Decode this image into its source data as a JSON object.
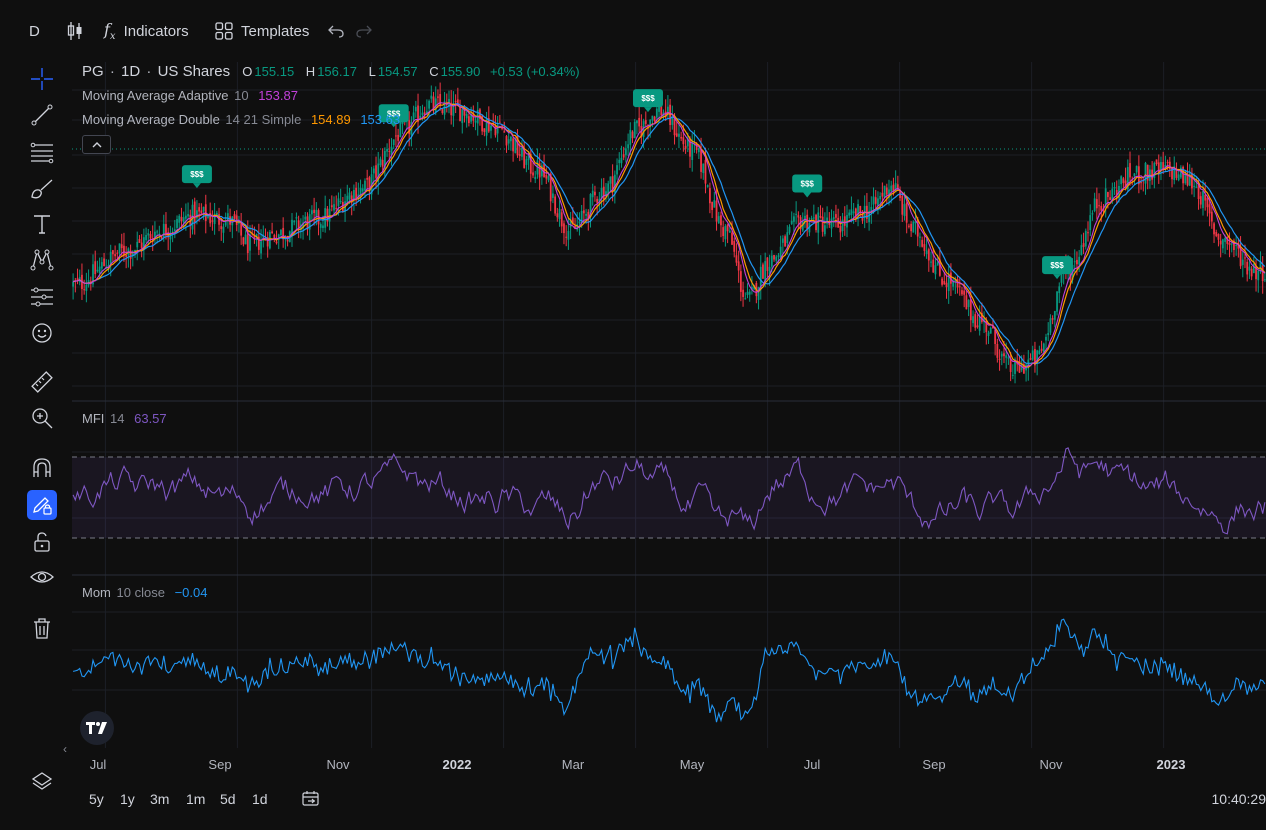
{
  "toolbar": {
    "interval": "D",
    "indicators_label": "Indicators",
    "templates_label": "Templates"
  },
  "legend": {
    "symbol": "PG",
    "interval": "1D",
    "exchange": "US Shares",
    "open_label": "O",
    "open": "155.15",
    "high_label": "H",
    "high": "156.17",
    "low_label": "L",
    "low": "154.57",
    "close_label": "C",
    "close": "155.90",
    "change": "+0.53 (+0.34%)",
    "ma_adaptive_name": "Moving Average Adaptive",
    "ma_adaptive_params": "10",
    "ma_adaptive_value": "153.87",
    "ma_double_name": "Moving Average Double",
    "ma_double_params": "14 21 Simple",
    "ma_double_value1": "154.89",
    "ma_double_value2": "153.63"
  },
  "mfi": {
    "name": "MFI",
    "params": "14",
    "value": "63.57"
  },
  "mom": {
    "name": "Mom",
    "params": "10 close",
    "value": "−0.04"
  },
  "colors": {
    "up": "#089981",
    "down": "#f23645",
    "ma_adaptive": "#c240d9",
    "ma_fast": "#ff9800",
    "ma_slow": "#2196f3",
    "mfi": "#7e57c2",
    "mom": "#2196f3",
    "accent": "#2962ff"
  },
  "dividend_badge": "$$$",
  "chart_data": {
    "type": "candlestick",
    "x_ticks": [
      "Jul",
      "Sep",
      "Nov",
      "2022",
      "Mar",
      "May",
      "Jul",
      "Sep",
      "Nov",
      "2023"
    ],
    "price_anchors": [
      {
        "t": 0,
        "p": 144.5
      },
      {
        "t": 25,
        "p": 148
      },
      {
        "t": 40,
        "p": 150
      },
      {
        "t": 55,
        "p": 151.5
      },
      {
        "t": 70,
        "p": 151
      },
      {
        "t": 80,
        "p": 148.5
      },
      {
        "t": 90,
        "p": 149.5
      },
      {
        "t": 110,
        "p": 151
      },
      {
        "t": 130,
        "p": 154
      },
      {
        "t": 150,
        "p": 160
      },
      {
        "t": 160,
        "p": 162.5
      },
      {
        "t": 175,
        "p": 162
      },
      {
        "t": 190,
        "p": 160.5
      },
      {
        "t": 210,
        "p": 156
      },
      {
        "t": 225,
        "p": 150
      },
      {
        "t": 240,
        "p": 154
      },
      {
        "t": 255,
        "p": 160
      },
      {
        "t": 265,
        "p": 162
      },
      {
        "t": 280,
        "p": 158
      },
      {
        "t": 295,
        "p": 150
      },
      {
        "t": 305,
        "p": 143
      },
      {
        "t": 315,
        "p": 147
      },
      {
        "t": 330,
        "p": 151
      },
      {
        "t": 345,
        "p": 150.5
      },
      {
        "t": 360,
        "p": 152
      },
      {
        "t": 370,
        "p": 154.5
      },
      {
        "t": 380,
        "p": 150
      },
      {
        "t": 395,
        "p": 145
      },
      {
        "t": 410,
        "p": 141
      },
      {
        "t": 425,
        "p": 136
      },
      {
        "t": 435,
        "p": 137
      },
      {
        "t": 450,
        "p": 146
      },
      {
        "t": 465,
        "p": 153
      },
      {
        "t": 480,
        "p": 155.5
      },
      {
        "t": 495,
        "p": 156
      },
      {
        "t": 505,
        "p": 155
      },
      {
        "t": 520,
        "p": 149
      },
      {
        "t": 535,
        "p": 146
      }
    ],
    "dividends": [
      56,
      145,
      260,
      332,
      445
    ],
    "mfi_levels": {
      "upper": 80,
      "lower": 20
    },
    "mom_range": [
      -10,
      12
    ]
  }
}
